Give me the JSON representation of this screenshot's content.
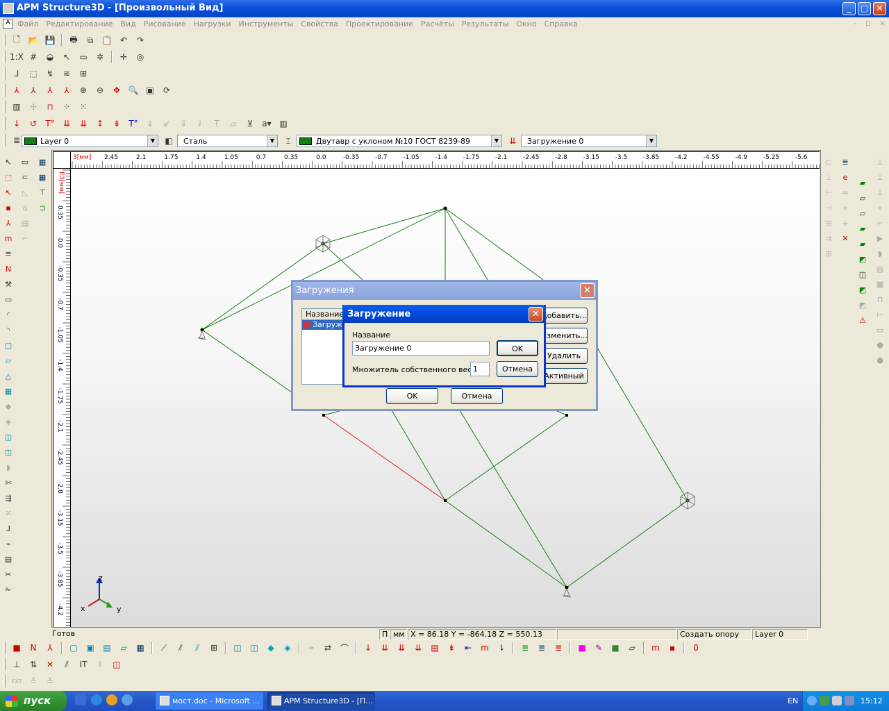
{
  "window": {
    "title": "APM Structure3D - [Произвольный Вид]"
  },
  "menu": [
    "Файл",
    "Редактирование",
    "Вид",
    "Рисование",
    "Нагрузки",
    "Инструменты",
    "Свойства",
    "Проектирование",
    "Расчёты",
    "Результаты",
    "Окно",
    "Справка"
  ],
  "toolbar_props": {
    "layer": "Layer 0",
    "material": "Сталь",
    "section": "Двутавр с уклоном  №10 ГОСТ 8239-89",
    "loading": "Загружение 0"
  },
  "ruler": {
    "unit_h": "3[мм]",
    "unit_v": "E3[мм]",
    "h_ticks": [
      "2.45",
      "2.1",
      "1.75",
      "1.4",
      "1.05",
      "0.7",
      "0.35",
      "0.0",
      "-0.35",
      "-0.7",
      "-1.05",
      "-1.4",
      "-1.75",
      "-2.1",
      "-2.45",
      "-2.8",
      "-3.15",
      "-3.5",
      "-3.85",
      "-4.2",
      "-4.55",
      "-4.9",
      "-5.25",
      "-5.6"
    ],
    "v_ticks": [
      "0.35",
      "0.0",
      "-0.35",
      "-0.7",
      "-1.05",
      "-1.4",
      "-1.75",
      "-2.1",
      "-2.45",
      "-2.8",
      "-3.15",
      "-3.5",
      "-3.85",
      "-4.2"
    ]
  },
  "axes": {
    "z": "z",
    "x": "x",
    "y": "y"
  },
  "status": {
    "ready": "Готов",
    "p": "П",
    "mm": "мм",
    "coords": "X = 86.18 Y = -864.18 Z = 550.13",
    "hint": "Создать опору",
    "layer": "Layer 0"
  },
  "dialog_loads": {
    "title": "Загружения",
    "list_header": "Название",
    "list_item": "Загруже",
    "btn_add": "Добавить...",
    "btn_edit": "Изменить...",
    "btn_delete": "Удалить",
    "btn_active": "Активный",
    "btn_ok": "OK",
    "btn_cancel": "Отмена"
  },
  "dialog_load": {
    "title": "Загружение",
    "name_label": "Название",
    "name_value": "Загружение 0",
    "weight_label": "Множитель собственного веса",
    "weight_value": "1",
    "btn_ok": "OK",
    "btn_cancel": "Отмена"
  },
  "taskbar": {
    "start": "пуск",
    "tasks": [
      "мост.doc - Microsoft ...",
      "APM Structure3D - [П..."
    ],
    "lang": "EN",
    "time": "15:12"
  },
  "colors": {
    "member": "#1a7a1a",
    "selected_member": "#e02020",
    "xp_blue": "#0a5cef"
  }
}
